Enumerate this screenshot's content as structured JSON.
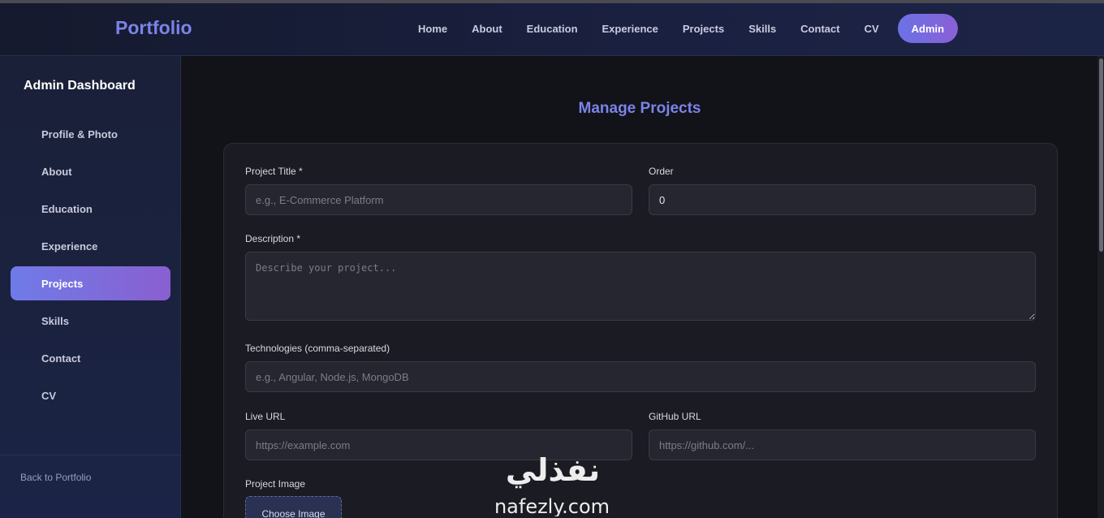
{
  "navbar": {
    "brand": "Portfolio",
    "links": [
      "Home",
      "About",
      "Education",
      "Experience",
      "Projects",
      "Skills",
      "Contact",
      "CV"
    ],
    "admin_label": "Admin",
    "admin_color_start": "#6b72e6",
    "admin_color_end": "#8a5fd6"
  },
  "sidebar": {
    "title": "Admin Dashboard",
    "items": [
      "Profile & Photo",
      "About",
      "Education",
      "Experience",
      "Projects",
      "Skills",
      "Contact",
      "CV"
    ],
    "active_item": "Projects",
    "back_link": "Back to Portfolio"
  },
  "main": {
    "title": "Manage Projects",
    "form": {
      "project_title_label": "Project Title *",
      "project_title_placeholder": "e.g., E-Commerce Platform",
      "order_label": "Order",
      "order_value": "0",
      "description_label": "Description *",
      "description_placeholder": "Describe your project...",
      "technologies_label": "Technologies (comma-separated)",
      "technologies_placeholder": "e.g., Angular, Node.js, MongoDB",
      "live_url_label": "Live URL",
      "live_url_placeholder": "https://example.com",
      "github_url_label": "GitHub URL",
      "github_url_placeholder": "https://github.com/...",
      "project_image_label": "Project Image",
      "choose_image_label": "Choose Image"
    }
  },
  "watermark": {
    "arabic_text": "نفذلي",
    "latin_text": "nafezly.com"
  },
  "colors": {
    "accent": "#7b83e8",
    "background": "#12121a",
    "card": "#1b1b23",
    "sidebar_active_start": "#6f7be8",
    "sidebar_active_end": "#8a5fd0"
  }
}
